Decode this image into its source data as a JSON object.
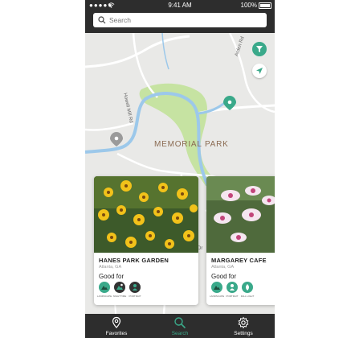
{
  "status_bar": {
    "carrier": "●●●●●",
    "time": "9:41 AM",
    "battery": "100%"
  },
  "search": {
    "placeholder": "Search"
  },
  "map": {
    "park_label": "MEMORIAL PARK",
    "roads": [
      "Howell Mill Rd",
      "Arden Rd",
      "Dr"
    ]
  },
  "cards": [
    {
      "title": "HANES PARK GARDEN",
      "location": "Atlanta, GA",
      "good_for_label": "Good for",
      "badges": [
        "LANDSCAPE",
        "NIGHTTIME",
        "PORTRAIT"
      ]
    },
    {
      "title": "MARGAREY CAFE",
      "location": "Atlanta, GA",
      "good_for_label": "Good for",
      "badges": [
        "LANDSCAPE",
        "PORTRAIT",
        "FALL LIGHT"
      ]
    }
  ],
  "bottom_nav": [
    {
      "label": "Favorites",
      "icon": "map-pin-icon",
      "active": false
    },
    {
      "label": "Search",
      "icon": "search-icon",
      "active": true
    },
    {
      "label": "Settings",
      "icon": "gear-icon",
      "active": false
    }
  ],
  "colors": {
    "accent": "#3aa98a",
    "bar": "#2d2d2d",
    "river": "#9cc8ea",
    "park": "#c6e3a2"
  }
}
